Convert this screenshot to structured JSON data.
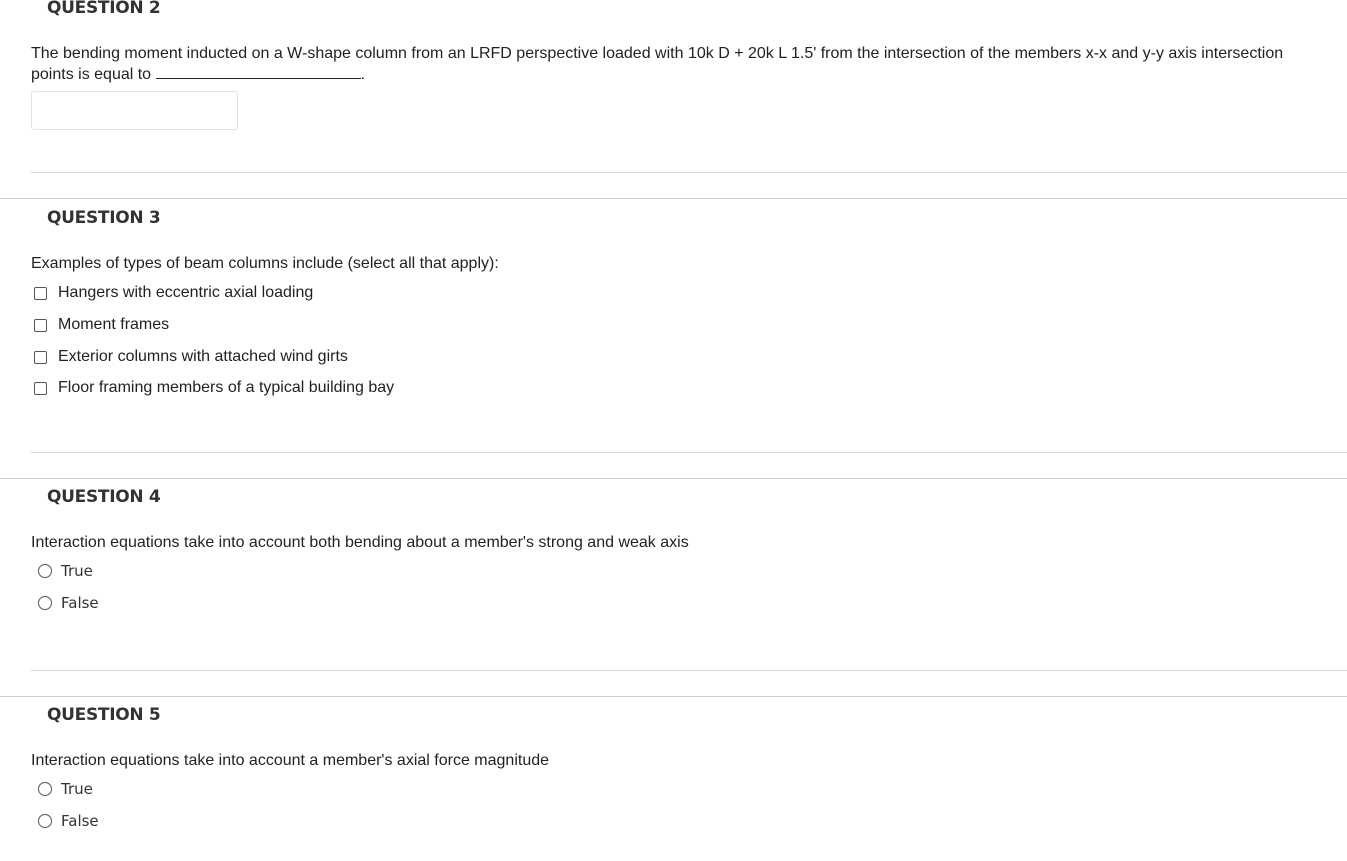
{
  "questions": [
    {
      "title": "QUESTION 2",
      "text_line1": "The bending moment inducted on a W-shape column from an LRFD perspective loaded with 10k D + 20k L 1.5' from the intersection of the members x-x and y-y axis intersection",
      "text_line2": "points is equal to",
      "text_end": ".",
      "answer_value": ""
    },
    {
      "title": "QUESTION 3",
      "text": "Examples of types of beam columns include (select all that apply):",
      "options": [
        {
          "label": "Hangers with eccentric axial loading",
          "checked": false
        },
        {
          "label": "Moment frames",
          "checked": false
        },
        {
          "label": "Exterior columns with attached wind girts",
          "checked": false
        },
        {
          "label": "Floor framing members of a typical building bay",
          "checked": false
        }
      ]
    },
    {
      "title": "QUESTION 4",
      "text": "Interaction equations take into account both bending about a member's strong and weak axis",
      "options": [
        {
          "label": "True",
          "selected": false
        },
        {
          "label": "False",
          "selected": false
        }
      ]
    },
    {
      "title": "QUESTION 5",
      "text": "Interaction equations take into account a member's axial force magnitude",
      "options": [
        {
          "label": "True",
          "selected": false
        },
        {
          "label": "False",
          "selected": false
        }
      ]
    }
  ]
}
